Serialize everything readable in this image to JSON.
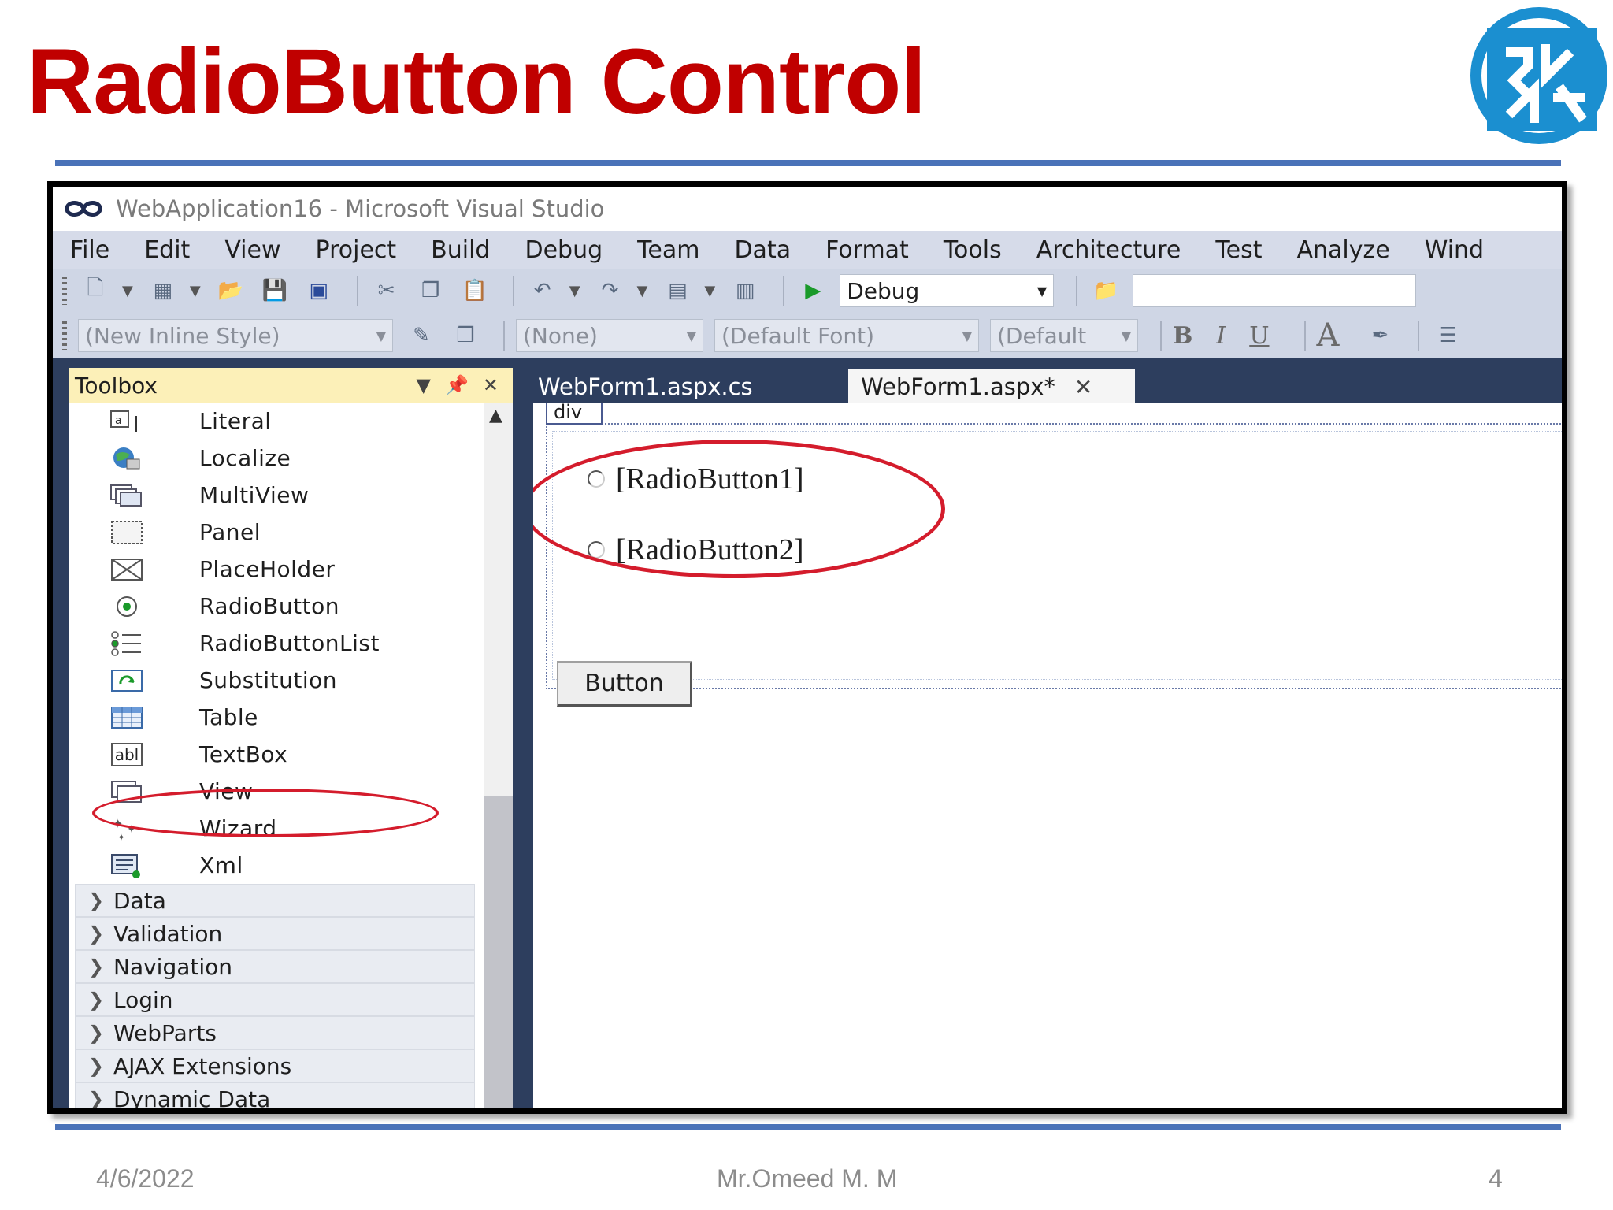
{
  "slide": {
    "title": "RadioButton Control",
    "footer_date": "4/6/2022",
    "footer_author": "Mr.Omeed M. M",
    "page_number": "4",
    "title_color": "#c00000",
    "rule_color": "#4a72b8"
  },
  "vs": {
    "window_title": "WebApplication16 - Microsoft Visual Studio",
    "menu": [
      "File",
      "Edit",
      "View",
      "Project",
      "Build",
      "Debug",
      "Team",
      "Data",
      "Format",
      "Tools",
      "Architecture",
      "Test",
      "Analyze",
      "Wind"
    ],
    "toolbar1": {
      "config_value": "Debug",
      "icons": [
        "new-project-icon",
        "new-website-icon",
        "open-folder-icon",
        "save-icon",
        "save-all-icon",
        "cut-icon",
        "copy-icon",
        "paste-icon",
        "undo-icon",
        "redo-icon",
        "navigate-back-icon",
        "navigate-forward-icon",
        "start-debug-icon",
        "find-in-files-icon"
      ]
    },
    "toolbar2": {
      "style_combo": "(New Inline Style)",
      "target_combo": "(None)",
      "font_combo": "(Default Font)",
      "size_combo": "(Default",
      "bold": "B",
      "italic": "I",
      "underline": "U",
      "font_color": "A"
    },
    "toolbox": {
      "title": "Toolbox",
      "items": [
        {
          "label": "Literal",
          "icon": "literal-icon"
        },
        {
          "label": "Localize",
          "icon": "localize-icon"
        },
        {
          "label": "MultiView",
          "icon": "multiview-icon"
        },
        {
          "label": "Panel",
          "icon": "panel-icon"
        },
        {
          "label": "PlaceHolder",
          "icon": "placeholder-icon"
        },
        {
          "label": "RadioButton",
          "icon": "radiobutton-icon"
        },
        {
          "label": "RadioButtonList",
          "icon": "radiobuttonlist-icon"
        },
        {
          "label": "Substitution",
          "icon": "substitution-icon"
        },
        {
          "label": "Table",
          "icon": "table-icon"
        },
        {
          "label": "TextBox",
          "icon": "textbox-icon"
        },
        {
          "label": "View",
          "icon": "view-icon"
        },
        {
          "label": "Wizard",
          "icon": "wizard-icon"
        },
        {
          "label": "Xml",
          "icon": "xml-icon"
        }
      ],
      "textbox_icon_text": "abl",
      "categories": [
        "Data",
        "Validation",
        "Navigation",
        "Login",
        "WebParts",
        "AJAX Extensions",
        "Dynamic Data"
      ]
    },
    "tabs": {
      "inactive": "WebForm1.aspx.cs",
      "active": "WebForm1.aspx*"
    },
    "designer": {
      "div_tag": "div",
      "radio1": "[RadioButton1]",
      "radio2": "[RadioButton2]",
      "button": "Button"
    },
    "colors": {
      "body_bg": "#2d3e5e",
      "menu_bg": "#d6dbe9",
      "toolbox_header_bg": "#fcf0b8",
      "highlight_red": "#d41c2c"
    }
  }
}
